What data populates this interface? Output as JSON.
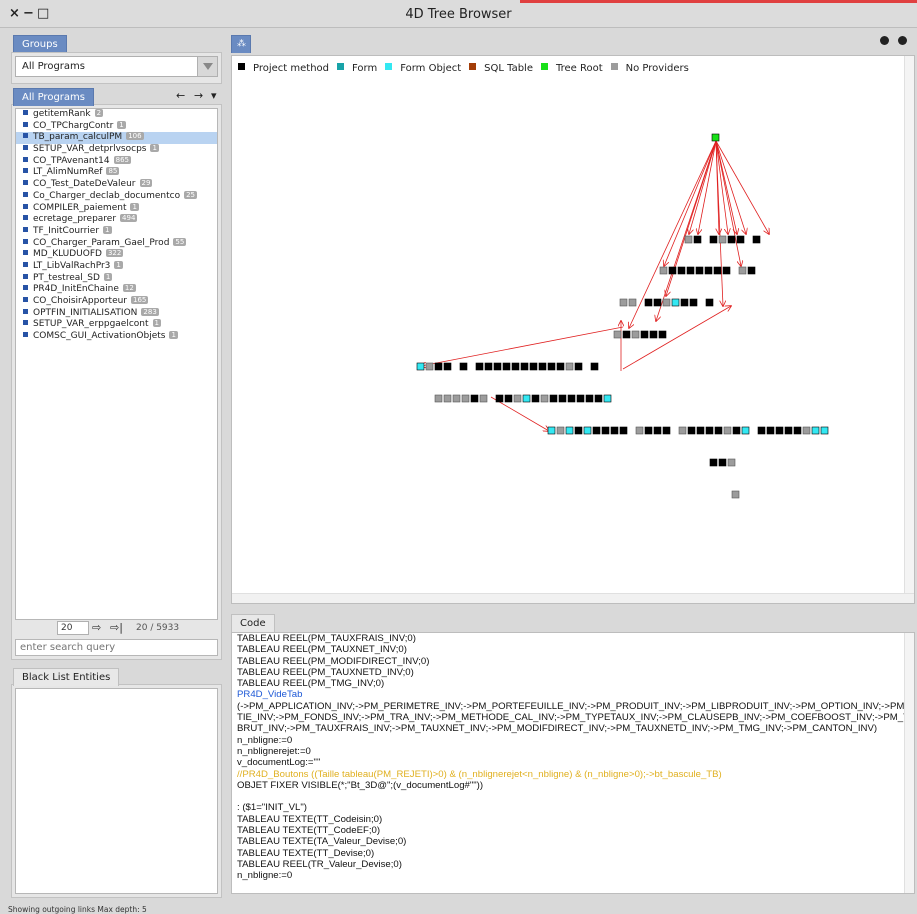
{
  "window": {
    "title": "4D Tree Browser",
    "controls": {
      "close": "×",
      "minimize": "−",
      "maximize": "□"
    }
  },
  "groups": {
    "tab_label": "Groups",
    "selected": "All Programs"
  },
  "programs": {
    "tab_label": "All Programs",
    "nav": {
      "back": "←",
      "forward": "→",
      "menu": "▾"
    },
    "items": [
      {
        "name": "getitemRank",
        "count": "2"
      },
      {
        "name": "CO_TPChargContr",
        "count": "1"
      },
      {
        "name": "TB_param_calculPM",
        "count": "106"
      },
      {
        "name": "SETUP_VAR_detprlvsocps",
        "count": "1"
      },
      {
        "name": "CO_TPAvenant14",
        "count": "865"
      },
      {
        "name": "LT_AlimNumRef",
        "count": "85"
      },
      {
        "name": "CO_Test_DateDeValeur",
        "count": "29"
      },
      {
        "name": "Co_Charger_declab_documentco",
        "count": "25"
      },
      {
        "name": "COMPILER_paiement",
        "count": "1"
      },
      {
        "name": "ecretage_preparer",
        "count": "494"
      },
      {
        "name": "TF_InitCourrier",
        "count": "1"
      },
      {
        "name": "CO_Charger_Param_Gael_Prod",
        "count": "55"
      },
      {
        "name": "MD_KLUDUOFD",
        "count": "322"
      },
      {
        "name": "LT_LibValRachPr3",
        "count": "1"
      },
      {
        "name": "PT_testreal_SD",
        "count": "1"
      },
      {
        "name": "PR4D_InitEnChaine",
        "count": "12"
      },
      {
        "name": "CO_ChoisirApporteur",
        "count": "165"
      },
      {
        "name": "OPTFIN_INITIALISATION",
        "count": "283"
      },
      {
        "name": "SETUP_VAR_erppgaelcont",
        "count": "1"
      },
      {
        "name": "COMSC_GUI_ActivationObjets",
        "count": "1"
      }
    ],
    "page_size": "20",
    "page_info": "20 / 5933",
    "search_placeholder": "enter search query"
  },
  "blacklist": {
    "tab_label": "Black List Entities"
  },
  "graph": {
    "legend": [
      {
        "label": "Project method",
        "color": "#000000"
      },
      {
        "label": "Form",
        "color": "#17a3a8"
      },
      {
        "label": "Form Object",
        "color": "#33e8f2"
      },
      {
        "label": "SQL Table",
        "color": "#a33d08"
      },
      {
        "label": "Tree Root",
        "color": "#18e018"
      },
      {
        "label": "No Providers",
        "color": "#9c9c9c"
      }
    ]
  },
  "code": {
    "tab_label": "Code",
    "lines": [
      {
        "text": "TABLEAU REEL(PM_TAUXFRAIS_INV;0)",
        "style": "normal"
      },
      {
        "text": "TABLEAU REEL(PM_TAUXNET_INV;0)",
        "style": "normal"
      },
      {
        "text": "TABLEAU REEL(PM_MODIFDIRECT_INV;0)",
        "style": "normal"
      },
      {
        "text": "TABLEAU REEL(PM_TAUXNETD_INV;0)",
        "style": "normal"
      },
      {
        "text": "TABLEAU REEL(PM_TMG_INV;0)",
        "style": "normal"
      },
      {
        "text": "PR4D_VideTab",
        "style": "blue"
      },
      {
        "text": "(->PM_APPLICATION_INV;->PM_PERIMETRE_INV;->PM_PORTEFEUILLE_INV;->PM_PRODUIT_INV;->PM_LIBPRODUIT_INV;->PM_OPTION_INV;->PM_GARAN",
        "style": "normal"
      },
      {
        "text": "TIE_INV;->PM_FONDS_INV;->PM_TRA_INV;->PM_METHODE_CAL_INV;->PM_TYPETAUX_INV;->PM_CLAUSEPB_INV;->PM_COEFBOOST_INV;->PM_TAUX",
        "style": "normal"
      },
      {
        "text": "BRUT_INV;->PM_TAUXFRAIS_INV;->PM_TAUXNET_INV;->PM_MODIFDIRECT_INV;->PM_TAUXNETD_INV;->PM_TMG_INV;->PM_CANTON_INV)",
        "style": "normal"
      },
      {
        "text": "n_nbligne:=0",
        "style": "normal"
      },
      {
        "text": "n_nblignerejet:=0",
        "style": "normal"
      },
      {
        "text": "v_documentLog:=\"\"",
        "style": "normal"
      },
      {
        "text": "//PR4D_Boutons ((Taille tableau(PM_REJETI)>0) & (n_nblignerejet<n_nbligne) & (n_nbligne>0);->bt_bascule_TB)",
        "style": "yellow"
      },
      {
        "text": "OBJET FIXER VISIBLE(*;\"Bt_3D@\";(v_documentLog#\"\"))",
        "style": "normal"
      },
      {
        "text": "",
        "style": "normal"
      },
      {
        "text": ": ($1=\"INIT_VL\")",
        "style": "normal"
      },
      {
        "text": "TABLEAU TEXTE(TT_Codeisin;0)",
        "style": "normal"
      },
      {
        "text": "TABLEAU TEXTE(TT_CodeEF;0)",
        "style": "normal"
      },
      {
        "text": "TABLEAU TEXTE(TA_Valeur_Devise;0)",
        "style": "normal"
      },
      {
        "text": "TABLEAU TEXTE(TT_Devise;0)",
        "style": "normal"
      },
      {
        "text": "TABLEAU REEL(TR_Valeur_Devise;0)",
        "style": "normal"
      },
      {
        "text": "n_nbligne:=0",
        "style": "normal"
      }
    ]
  },
  "status": {
    "text": "Showing outgoing links   Max depth: 5"
  }
}
